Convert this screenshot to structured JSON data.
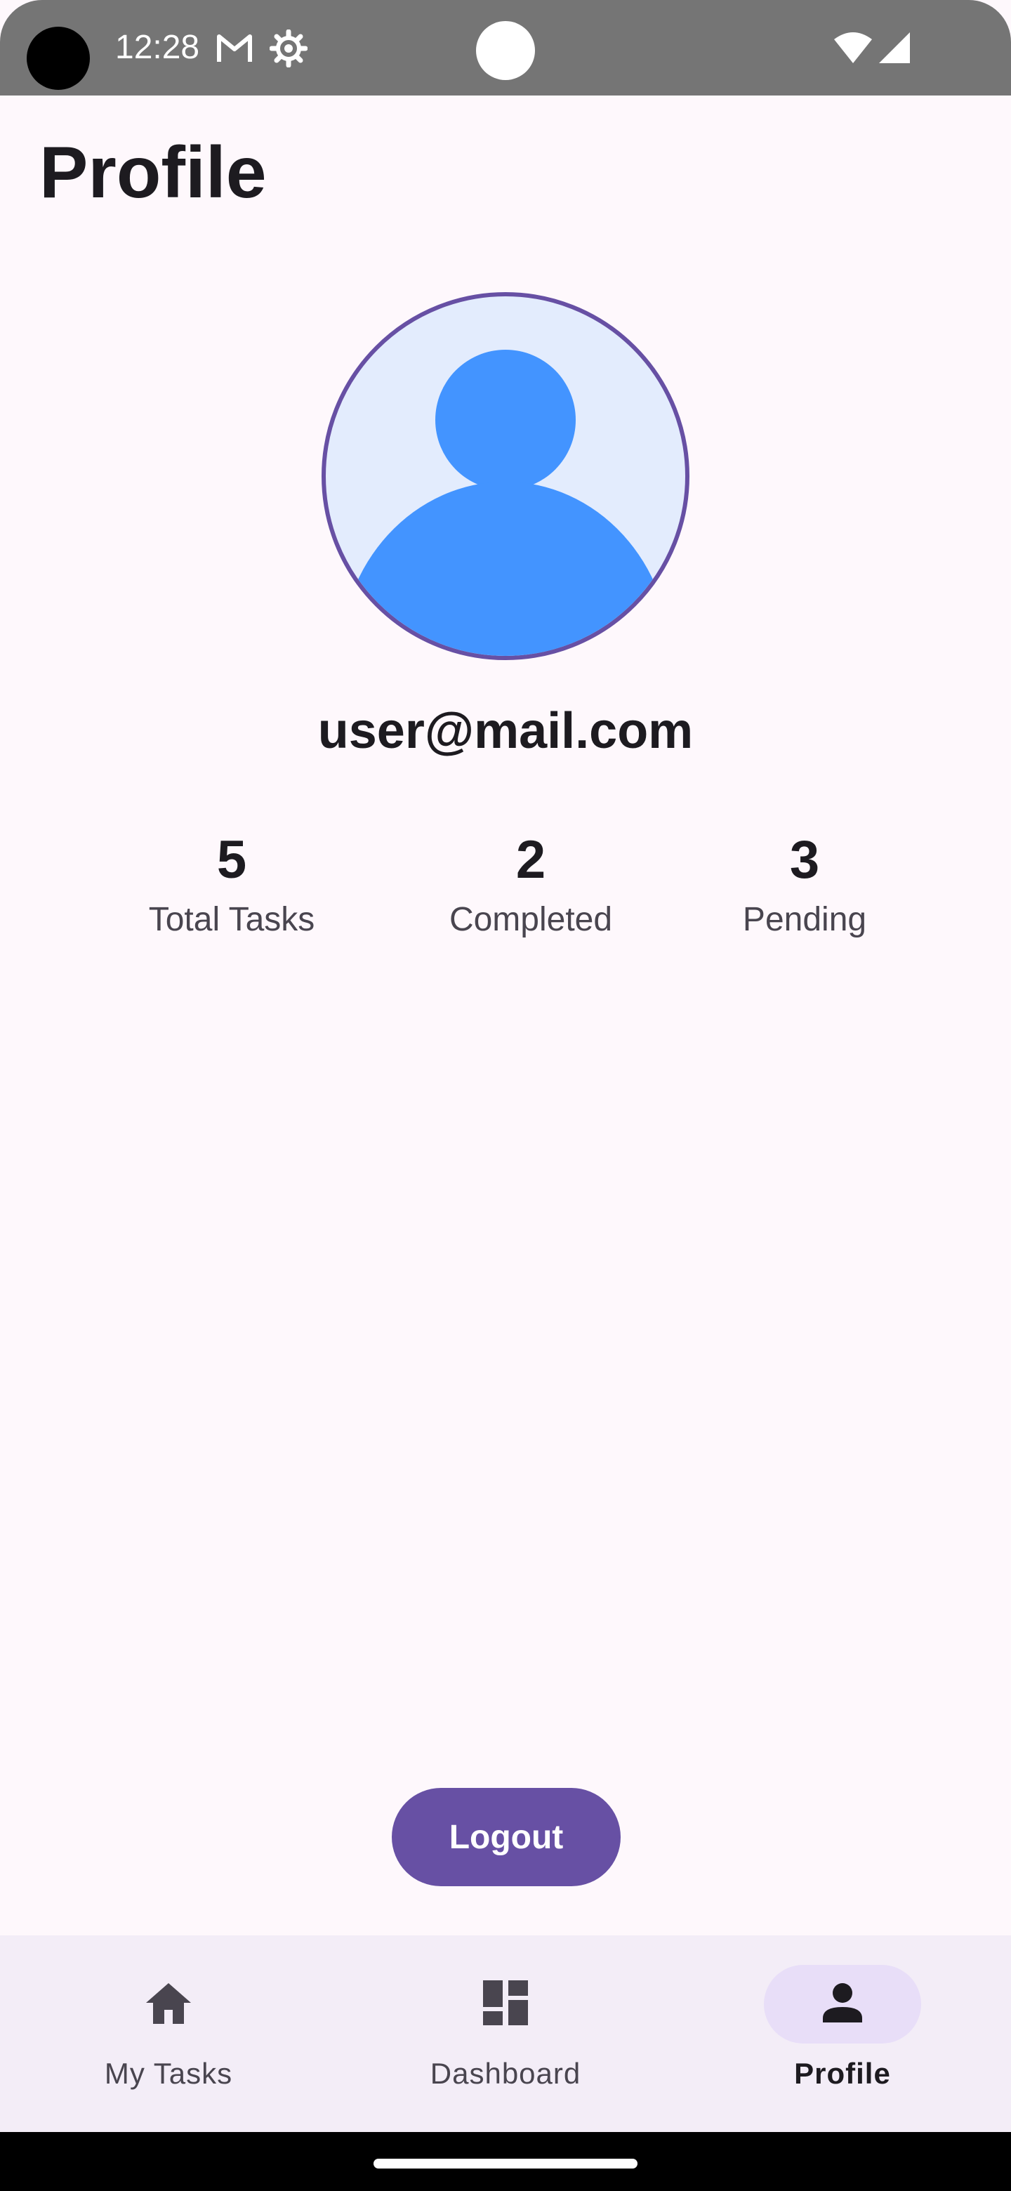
{
  "status_bar": {
    "time": "12:28",
    "icons": [
      "gmail-icon",
      "settings-gear-icon",
      "wifi-icon",
      "cell-signal-icon"
    ]
  },
  "page": {
    "title": "Profile"
  },
  "profile": {
    "email": "user@mail.com",
    "avatar_icon": "person-avatar-icon"
  },
  "stats": [
    {
      "value": "5",
      "label": "Total Tasks"
    },
    {
      "value": "2",
      "label": "Completed"
    },
    {
      "value": "3",
      "label": "Pending"
    }
  ],
  "actions": {
    "logout_label": "Logout"
  },
  "bottom_nav": {
    "items": [
      {
        "label": "My Tasks",
        "icon": "home-icon",
        "active": false
      },
      {
        "label": "Dashboard",
        "icon": "dashboard-icon",
        "active": false
      },
      {
        "label": "Profile",
        "icon": "person-icon",
        "active": true
      }
    ]
  },
  "colors": {
    "primary": "#6750A4",
    "background": "#FEF8FC",
    "avatar_bg": "#E3ECFD",
    "avatar_fg": "#4394FF",
    "nav_bg": "#F3EDF7",
    "nav_active_pill": "#E8DEF8"
  }
}
